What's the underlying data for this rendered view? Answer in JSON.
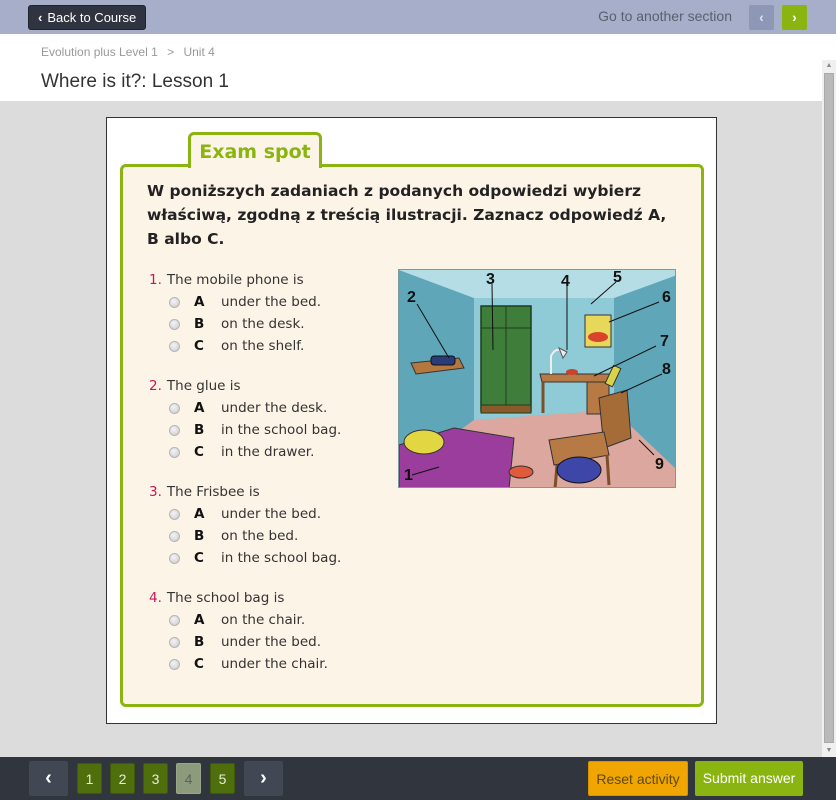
{
  "topbar": {
    "back_label": "Back to Course",
    "goto_label": "Go to another section",
    "prev_icon": "chevron-left-icon",
    "next_icon": "chevron-right-icon",
    "accent_color": "#8ab510"
  },
  "breadcrumb": {
    "items": [
      "Evolution plus Level 1",
      ">",
      "Unit 4"
    ]
  },
  "page_title": "Where is it?: Lesson 1",
  "exercise": {
    "tab_label": "Exam spot",
    "instruction": "W poniższych zadaniach z podanych odpowiedzi wybierz właściwą, zgodną z treścią ilustracji. Zaznacz odpowiedź A, B albo C.",
    "questions": [
      {
        "number": "1.",
        "text": "The mobile phone is",
        "options": [
          {
            "letter": "A",
            "text": "under the bed."
          },
          {
            "letter": "B",
            "text": "on the desk."
          },
          {
            "letter": "C",
            "text": "on the shelf."
          }
        ]
      },
      {
        "number": "2.",
        "text": "The glue is",
        "options": [
          {
            "letter": "A",
            "text": "under the desk."
          },
          {
            "letter": "B",
            "text": "in the school bag."
          },
          {
            "letter": "C",
            "text": "in the drawer."
          }
        ]
      },
      {
        "number": "3.",
        "text": "The Frisbee is",
        "options": [
          {
            "letter": "A",
            "text": "under the bed."
          },
          {
            "letter": "B",
            "text": "on the bed."
          },
          {
            "letter": "C",
            "text": "in the school bag."
          }
        ]
      },
      {
        "number": "4.",
        "text": "The school bag is",
        "options": [
          {
            "letter": "A",
            "text": "on the chair."
          },
          {
            "letter": "B",
            "text": "under the bed."
          },
          {
            "letter": "C",
            "text": "under the chair."
          }
        ]
      }
    ],
    "illustration": {
      "description": "Cartoon bedroom with numbered items",
      "labels": [
        "1",
        "2",
        "3",
        "4",
        "5",
        "6",
        "7",
        "8",
        "9"
      ]
    }
  },
  "footer": {
    "prev_icon": "chevron-left-icon",
    "next_icon": "chevron-right-icon",
    "pages": [
      "1",
      "2",
      "3",
      "4",
      "5"
    ],
    "current_page": "4",
    "reset_label": "Reset activity",
    "submit_label": "Submit answer"
  }
}
